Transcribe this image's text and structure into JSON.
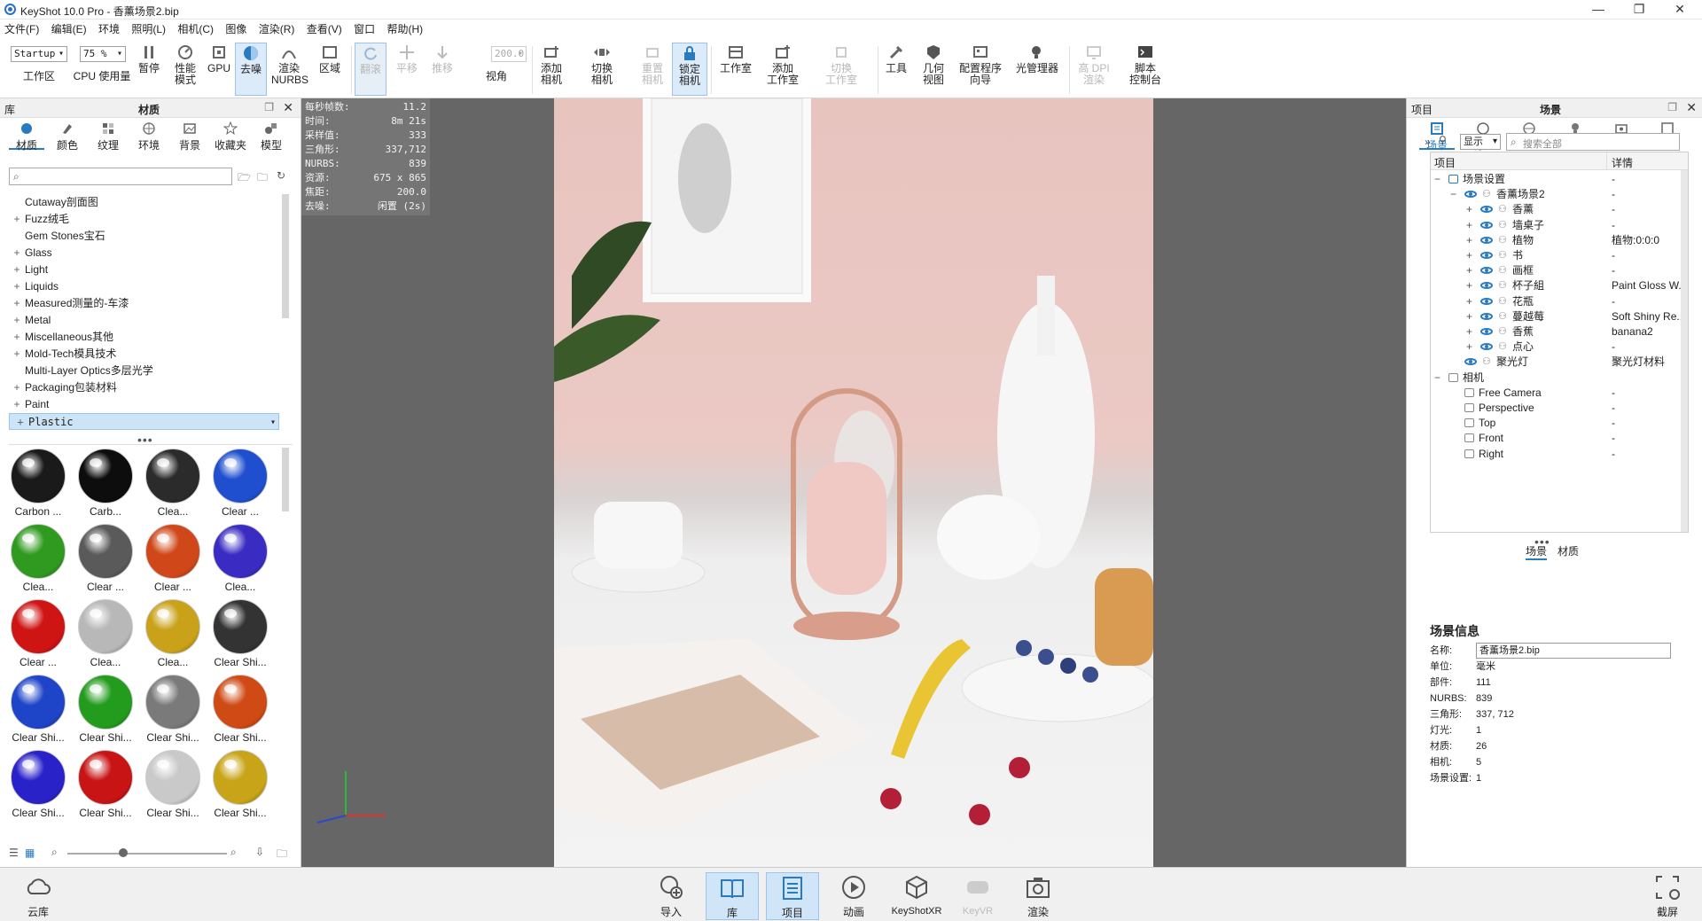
{
  "window": {
    "title": "KeyShot 10.0 Pro  - 香薰场景2.bip",
    "minimize": "—",
    "restore": "❐",
    "close": "✕"
  },
  "menu": [
    "文件(F)",
    "编辑(E)",
    "环境",
    "照明(L)",
    "相机(C)",
    "图像",
    "渲染(R)",
    "查看(V)",
    "窗口",
    "帮助(H)"
  ],
  "toolbar": {
    "workspace_select": "Startup",
    "zoom_select": "75 %",
    "fov_value": "200.0",
    "buttons": [
      {
        "label": "工作区",
        "icon": "workspace-icon"
      },
      {
        "label": "CPU 使用量",
        "icon": "cpu-icon"
      },
      {
        "label": "暂停",
        "icon": "pause-icon"
      },
      {
        "label": "性能\n模式",
        "icon": "performance-icon"
      },
      {
        "label": "GPU",
        "icon": "gpu-icon"
      },
      {
        "label": "去噪",
        "icon": "denoise-icon"
      },
      {
        "label": "渲染\nNURBS",
        "icon": "nurbs-icon"
      },
      {
        "label": "区域",
        "icon": "region-icon"
      },
      {
        "label": "翻滚",
        "icon": "tumble-icon"
      },
      {
        "label": "平移",
        "icon": "pan-icon"
      },
      {
        "label": "推移",
        "icon": "dolly-icon"
      },
      {
        "label": "视角",
        "icon": "fov-icon"
      },
      {
        "label": "添加\n相机",
        "icon": "add-camera-icon"
      },
      {
        "label": "切换\n相机",
        "icon": "switch-camera-icon"
      },
      {
        "label": "重置\n相机",
        "icon": "reset-camera-icon"
      },
      {
        "label": "锁定\n相机",
        "icon": "lock-camera-icon"
      },
      {
        "label": "工作室",
        "icon": "studio-icon"
      },
      {
        "label": "添加\n工作室",
        "icon": "add-studio-icon"
      },
      {
        "label": "切换\n工作室",
        "icon": "switch-studio-icon"
      },
      {
        "label": "工具",
        "icon": "tools-icon"
      },
      {
        "label": "几何\n视图",
        "icon": "geometry-view-icon"
      },
      {
        "label": "配置程序\n向导",
        "icon": "configurator-icon"
      },
      {
        "label": "光管理器",
        "icon": "light-manager-icon"
      },
      {
        "label": "高 DPI\n渲染",
        "icon": "hidpi-icon"
      },
      {
        "label": "脚本\n控制台",
        "icon": "script-console-icon"
      }
    ]
  },
  "library": {
    "header_left": "库",
    "header_center": "材质",
    "tabs": [
      "材质",
      "颜色",
      "纹理",
      "环境",
      "背景",
      "收藏夹",
      "模型"
    ],
    "tree": [
      {
        "label": "Cutaway剖面图",
        "expand": ""
      },
      {
        "label": "Fuzz绒毛",
        "expand": "+"
      },
      {
        "label": "Gem Stones宝石",
        "expand": ""
      },
      {
        "label": "Glass",
        "expand": "+"
      },
      {
        "label": "Light",
        "expand": "+"
      },
      {
        "label": "Liquids",
        "expand": "+"
      },
      {
        "label": "Measured测量的-车漆",
        "expand": "+"
      },
      {
        "label": "Metal",
        "expand": "+"
      },
      {
        "label": "Miscellaneous其他",
        "expand": "+"
      },
      {
        "label": "Mold-Tech模具技术",
        "expand": "+"
      },
      {
        "label": "Multi-Layer Optics多层光学",
        "expand": ""
      },
      {
        "label": "Packaging包装材料",
        "expand": "+"
      },
      {
        "label": "Paint",
        "expand": "+"
      },
      {
        "label": "Plastic",
        "expand": "+"
      }
    ],
    "swatches": [
      {
        "label": "Carbon ...",
        "color": "#1a1a1a"
      },
      {
        "label": "Carb...",
        "color": "#0d0d0d"
      },
      {
        "label": "Clea...",
        "color": "#2b2b2b"
      },
      {
        "label": "Clear ...",
        "color": "#1f4fcf"
      },
      {
        "label": "Clea...",
        "color": "#2f9a1f"
      },
      {
        "label": "Clear ...",
        "color": "#5a5a5a"
      },
      {
        "label": "Clear ...",
        "color": "#d0481a"
      },
      {
        "label": "Clea...",
        "color": "#3a2cc2"
      },
      {
        "label": "Clear ...",
        "color": "#cf1414"
      },
      {
        "label": "Clea...",
        "color": "#b8b8b8"
      },
      {
        "label": "Clea...",
        "color": "#c9a21a"
      },
      {
        "label": "Clear Shi...",
        "color": "#333333"
      },
      {
        "label": "Clear Shi...",
        "color": "#1e44c8"
      },
      {
        "label": "Clear Shi...",
        "color": "#239c1d"
      },
      {
        "label": "Clear Shi...",
        "color": "#7a7a7a"
      },
      {
        "label": "Clear Shi...",
        "color": "#cf4a14"
      },
      {
        "label": "Clear Shi...",
        "color": "#2a22c9"
      },
      {
        "label": "Clear Shi...",
        "color": "#c81414"
      },
      {
        "label": "Clear Shi...",
        "color": "#c9c9c9"
      },
      {
        "label": "Clear Shi...",
        "color": "#c8a418"
      }
    ]
  },
  "hud": [
    {
      "k": "每秒帧数:",
      "v": "11.2"
    },
    {
      "k": "时间:",
      "v": "8m 21s"
    },
    {
      "k": "采样值:",
      "v": "333"
    },
    {
      "k": "三角形:",
      "v": "337,712"
    },
    {
      "k": "NURBS:",
      "v": "839"
    },
    {
      "k": "资源:",
      "v": "675 x 865"
    },
    {
      "k": "焦距:",
      "v": "200.0"
    },
    {
      "k": "去噪:",
      "v": "闲置 (2s)"
    }
  ],
  "project": {
    "header_left": "项目",
    "header_center": "场景",
    "tabs": [
      "场景",
      "材质",
      "环境",
      "照明",
      "相机",
      "图像"
    ],
    "show_select": "显示",
    "search_placeholder": "搜索全部",
    "col_item": "项目",
    "col_detail": "详情",
    "tree": [
      {
        "label": "场景设置",
        "detail": "-",
        "level": 0,
        "toggle": "−",
        "eye": false
      },
      {
        "label": "香薰场景2",
        "detail": "-",
        "level": 1,
        "toggle": "−",
        "eye": true
      },
      {
        "label": "香薰",
        "detail": "-",
        "level": 2,
        "toggle": "+",
        "eye": true
      },
      {
        "label": "墙桌子",
        "detail": "-",
        "level": 2,
        "toggle": "+",
        "eye": true
      },
      {
        "label": "植物",
        "detail": "植物:0:0:0",
        "level": 2,
        "toggle": "+",
        "eye": true
      },
      {
        "label": "书",
        "detail": "-",
        "level": 2,
        "toggle": "+",
        "eye": true
      },
      {
        "label": "画框",
        "detail": "-",
        "level": 2,
        "toggle": "+",
        "eye": true
      },
      {
        "label": "杯子組",
        "detail": "Paint Gloss W...",
        "level": 2,
        "toggle": "+",
        "eye": true
      },
      {
        "label": "花瓶",
        "detail": "-",
        "level": 2,
        "toggle": "+",
        "eye": true
      },
      {
        "label": "蔓越莓",
        "detail": "Soft Shiny Re...",
        "level": 2,
        "toggle": "+",
        "eye": true
      },
      {
        "label": "香蕉",
        "detail": "banana2",
        "level": 2,
        "toggle": "+",
        "eye": true
      },
      {
        "label": "点心",
        "detail": "-",
        "level": 2,
        "toggle": "+",
        "eye": true
      },
      {
        "label": "聚光灯",
        "detail": "聚光灯材料",
        "level": 1,
        "toggle": "",
        "eye": true
      },
      {
        "label": "相机",
        "detail": "",
        "level": 0,
        "toggle": "−",
        "eye": false
      },
      {
        "label": "Free Camera",
        "detail": "-",
        "level": 1,
        "toggle": "",
        "eye": false
      },
      {
        "label": "Perspective",
        "detail": "-",
        "level": 1,
        "toggle": "",
        "eye": false
      },
      {
        "label": "Top",
        "detail": "-",
        "level": 1,
        "toggle": "",
        "eye": false
      },
      {
        "label": "Front",
        "detail": "-",
        "level": 1,
        "toggle": "",
        "eye": false
      },
      {
        "label": "Right",
        "detail": "-",
        "level": 1,
        "toggle": "",
        "eye": false
      }
    ],
    "subtabs": [
      "场景",
      "材质"
    ],
    "info_title": "场景信息",
    "info": [
      {
        "k": "名称:",
        "v": "香薰场景2.bip"
      },
      {
        "k": "单位:",
        "v": "毫米"
      },
      {
        "k": "部件:",
        "v": "111"
      },
      {
        "k": "NURBS:",
        "v": "839"
      },
      {
        "k": "三角形:",
        "v": "337, 712"
      },
      {
        "k": "灯光:",
        "v": "1"
      },
      {
        "k": "材质:",
        "v": "26"
      },
      {
        "k": "相机:",
        "v": "5"
      },
      {
        "k": "场景设置:",
        "v": "1"
      }
    ]
  },
  "bottom": {
    "cloud": "云库",
    "buttons": [
      "导入",
      "库",
      "项目",
      "动画",
      "KeyShotXR",
      "KeyVR",
      "渲染"
    ],
    "screenshot": "截屏"
  },
  "colors": {
    "accent": "#2a7ac0",
    "selection": "#cde4f7",
    "viewport": "#666666"
  }
}
